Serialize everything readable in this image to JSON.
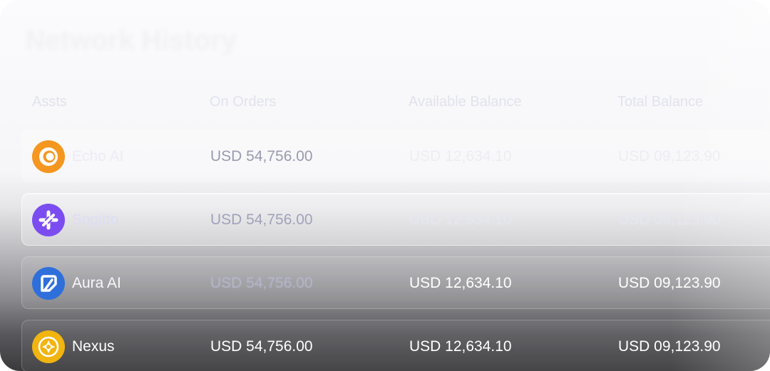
{
  "page": {
    "title": "Network History"
  },
  "table": {
    "columns": {
      "assets": "Assts",
      "on_orders": "On Orders",
      "available_balance": "Available Balance",
      "total_balance": "Total Balance"
    },
    "rows": [
      {
        "name": "Echo AI",
        "icon": "echo-ai-logo-icon",
        "icon_color": "#F5961F",
        "on_orders": "USD 54,756.00",
        "available": "USD 12,634.10",
        "total": "USD 09,123.90"
      },
      {
        "name": "Sogitto",
        "icon": "sogitto-logo-icon",
        "icon_color": "#7B4DF0",
        "on_orders": "USD 54,756.00",
        "available": "USD 12,634.10",
        "total": "USD 09,123.90"
      },
      {
        "name": "Aura AI",
        "icon": "aura-ai-logo-icon",
        "icon_color": "#2F6FDB",
        "on_orders": "USD 54,756.00",
        "available": "USD 12,634.10",
        "total": "USD 09,123.90"
      },
      {
        "name": "Nexus",
        "icon": "nexus-logo-icon",
        "icon_color": "#F2B40F",
        "on_orders": "USD 54,756.00",
        "available": "USD 12,634.10",
        "total": "USD 09,123.90"
      }
    ]
  }
}
